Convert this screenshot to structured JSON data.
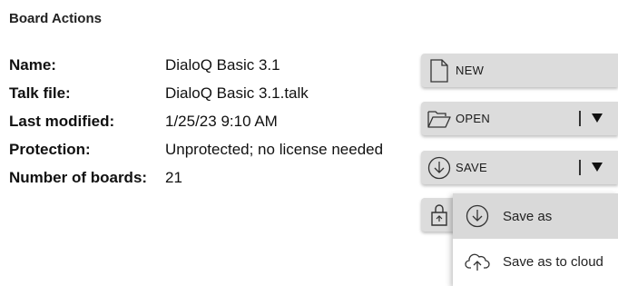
{
  "panel": {
    "title": "Board Actions"
  },
  "properties": [
    {
      "label": "Name:",
      "value": "DialoQ Basic 3.1"
    },
    {
      "label": "Talk file:",
      "value": "DialoQ Basic 3.1.talk"
    },
    {
      "label": "Last modified:",
      "value": "1/25/23 9:10 AM"
    },
    {
      "label": "Protection:",
      "value": "Unprotected; no license needed"
    },
    {
      "label": "Number of boards:",
      "value": "21"
    }
  ],
  "actions": {
    "new": {
      "label": "NEW",
      "icon": "file-icon"
    },
    "open": {
      "label": "OPEN",
      "icon": "folder-open-icon",
      "caret": "▼"
    },
    "save": {
      "label": "SAVE",
      "icon": "download-circle-icon",
      "caret": "▼"
    },
    "share": {
      "icon": "share-bag-icon"
    }
  },
  "save_menu": {
    "items": [
      {
        "label": "Save as",
        "icon": "download-circle-icon",
        "highlighted": true
      },
      {
        "label": "Save as to cloud",
        "icon": "cloud-upload-icon",
        "highlighted": false
      }
    ]
  },
  "colors": {
    "button_bg": "#dcdcdc",
    "menu_highlight": "#d9d9d9",
    "text": "#111111"
  }
}
